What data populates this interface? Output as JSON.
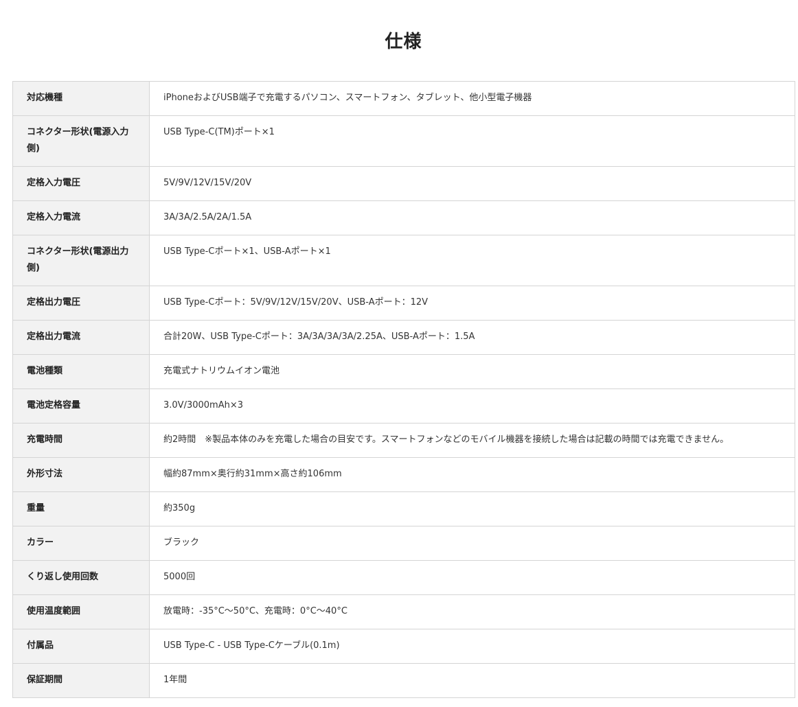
{
  "title": "仕様",
  "specs": [
    {
      "label": "対応機種",
      "value": "iPhoneおよびUSB端子で充電するパソコン、スマートフォン、タブレット、他小型電子機器"
    },
    {
      "label": "コネクター形状(電源入力側)",
      "value": "USB Type-C(TM)ポート×1"
    },
    {
      "label": "定格入力電圧",
      "value": "5V/9V/12V/15V/20V"
    },
    {
      "label": "定格入力電流",
      "value": "3A/3A/2.5A/2A/1.5A"
    },
    {
      "label": "コネクター形状(電源出力側)",
      "value": "USB Type-Cポート×1、USB-Aポート×1"
    },
    {
      "label": "定格出力電圧",
      "value": "USB Type-Cポート：5V/9V/12V/15V/20V、USB-Aポート：12V"
    },
    {
      "label": "定格出力電流",
      "value": "合計20W、USB Type-Cポート：3A/3A/3A/3A/2.25A、USB-Aポート：1.5A"
    },
    {
      "label": "電池種類",
      "value": "充電式ナトリウムイオン電池"
    },
    {
      "label": "電池定格容量",
      "value": "3.0V/3000mAh×3"
    },
    {
      "label": "充電時間",
      "value": "約2時間　※製品本体のみを充電した場合の目安です。スマートフォンなどのモバイル機器を接続した場合は記載の時間では充電できません。"
    },
    {
      "label": "外形寸法",
      "value": "幅約87mm×奥行約31mm×高さ約106mm"
    },
    {
      "label": "重量",
      "value": "約350g"
    },
    {
      "label": "カラー",
      "value": "ブラック"
    },
    {
      "label": "くり返し使用回数",
      "value": "5000回"
    },
    {
      "label": "使用温度範囲",
      "value": "放電時：-35°C～50°C、充電時：0°C～40°C"
    },
    {
      "label": "付属品",
      "value": "USB Type-C - USB Type-Cケーブル(0.1m)"
    },
    {
      "label": "保証期間",
      "value": "1年間"
    }
  ]
}
